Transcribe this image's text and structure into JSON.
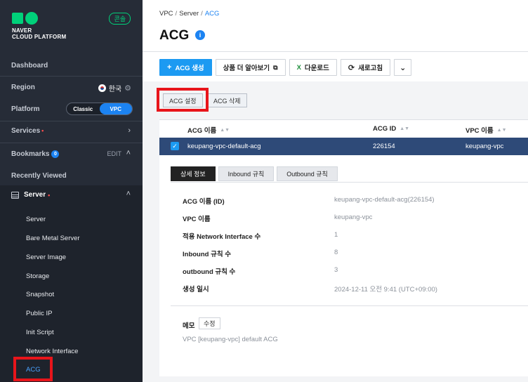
{
  "sidebar": {
    "brand_line1": "NAVER",
    "brand_line2": "CLOUD PLATFORM",
    "console_badge": "콘솔",
    "dashboard": "Dashboard",
    "region_label": "Region",
    "region_value": "한국",
    "platform_label": "Platform",
    "platform_options": [
      "Classic",
      "VPC"
    ],
    "platform_selected": "VPC",
    "services": "Services",
    "bookmarks": "Bookmarks",
    "bookmarks_count": "0",
    "edit": "EDIT",
    "recently_viewed": "Recently Viewed",
    "server_section": "Server",
    "server_items": [
      "Server",
      "Bare Metal Server",
      "Server Image",
      "Storage",
      "Snapshot",
      "Public IP",
      "Init Script",
      "Network Interface",
      "ACG"
    ],
    "active_item": "ACG"
  },
  "breadcrumb": [
    "VPC",
    "Server",
    "ACG"
  ],
  "page": {
    "title": "ACG",
    "info_badge": "i"
  },
  "toolbar": {
    "create": "ACG 생성",
    "more_products": "상품 더 알아보기",
    "download": "다운로드",
    "refresh": "새로고침"
  },
  "actions": {
    "settings": "ACG 설정",
    "delete": "ACG 삭제"
  },
  "table": {
    "headers": [
      "ACG 이름",
      "ACG ID",
      "VPC 이름"
    ],
    "selected_row": [
      "keupang-vpc-default-acg",
      "226154",
      "keupang-vpc"
    ]
  },
  "detail_tabs": [
    "상세 정보",
    "Inbound 규칙",
    "Outbound 규칙"
  ],
  "detail": {
    "rows": [
      {
        "label": "ACG 이름 (ID)",
        "value": "keupang-vpc-default-acg(226154)"
      },
      {
        "label": "VPC 이름",
        "value": "keupang-vpc"
      },
      {
        "label": "적용 Network Interface 수",
        "value": "1"
      },
      {
        "label": "Inbound 규칙 수",
        "value": "8"
      },
      {
        "label": "outbound 규칙 수",
        "value": "3"
      },
      {
        "label": "생성 일시",
        "value": "2024-12-11 오전 9:41 (UTC+09:00)"
      }
    ],
    "memo_label": "메모",
    "memo_edit": "수정",
    "memo_text": "VPC [keupang-vpc] default ACG"
  },
  "colors": {
    "accent": "#1c83f2",
    "sidebar_bg": "#262c37",
    "brand_green": "#00d17a",
    "highlight_red": "#e8151b"
  }
}
